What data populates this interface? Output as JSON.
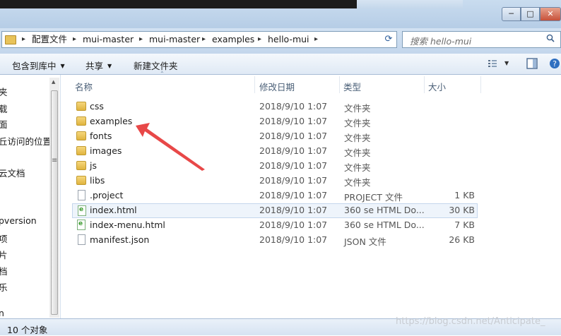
{
  "window": {
    "buttons": {
      "minimize": "─",
      "maximize": "□",
      "close": "✕"
    }
  },
  "address": {
    "crumbs": [
      "配置文件",
      "mui-master",
      "mui-master",
      "examples",
      "hello-mui"
    ],
    "separator": "▸",
    "dropdown_icon": "chevron-down-icon",
    "refresh_icon": "refresh-icon"
  },
  "search": {
    "placeholder": "搜索 hello-mui"
  },
  "toolbar": {
    "include_library": "包含到库中",
    "share": "共享",
    "new_folder": "新建文件夹"
  },
  "nav": {
    "items": [
      "夹",
      "载",
      "面",
      "丘访问的位置",
      "云文档",
      "pversion",
      "项",
      "片",
      "档",
      "乐",
      "n"
    ]
  },
  "columns": {
    "name": "名称",
    "modified": "修改日期",
    "type": "类型",
    "size": "大小"
  },
  "files": [
    {
      "name": "css",
      "date": "2018/9/10 1:07",
      "type": "文件夹",
      "size": "",
      "icon": "folder-icon"
    },
    {
      "name": "examples",
      "date": "2018/9/10 1:07",
      "type": "文件夹",
      "size": "",
      "icon": "folder-icon"
    },
    {
      "name": "fonts",
      "date": "2018/9/10 1:07",
      "type": "文件夹",
      "size": "",
      "icon": "folder-icon"
    },
    {
      "name": "images",
      "date": "2018/9/10 1:07",
      "type": "文件夹",
      "size": "",
      "icon": "folder-icon"
    },
    {
      "name": "js",
      "date": "2018/9/10 1:07",
      "type": "文件夹",
      "size": "",
      "icon": "folder-icon"
    },
    {
      "name": "libs",
      "date": "2018/9/10 1:07",
      "type": "文件夹",
      "size": "",
      "icon": "folder-icon"
    },
    {
      "name": ".project",
      "date": "2018/9/10 1:07",
      "type": "PROJECT 文件",
      "size": "1 KB",
      "icon": "file-icon"
    },
    {
      "name": "index.html",
      "date": "2018/9/10 1:07",
      "type": "360 se HTML Do...",
      "size": "30 KB",
      "icon": "html-file-icon",
      "selected": true
    },
    {
      "name": "index-menu.html",
      "date": "2018/9/10 1:07",
      "type": "360 se HTML Do...",
      "size": "7 KB",
      "icon": "html-file-icon"
    },
    {
      "name": "manifest.json",
      "date": "2018/9/10 1:07",
      "type": "JSON 文件",
      "size": "26 KB",
      "icon": "file-icon"
    }
  ],
  "status": {
    "count": "10 个对象"
  },
  "watermark": "https://blog.csdn.net/Anticipate_",
  "colors": {
    "accent": "#e84848",
    "selection": "#eef4fb",
    "toolbar": "#dfe9f5"
  }
}
